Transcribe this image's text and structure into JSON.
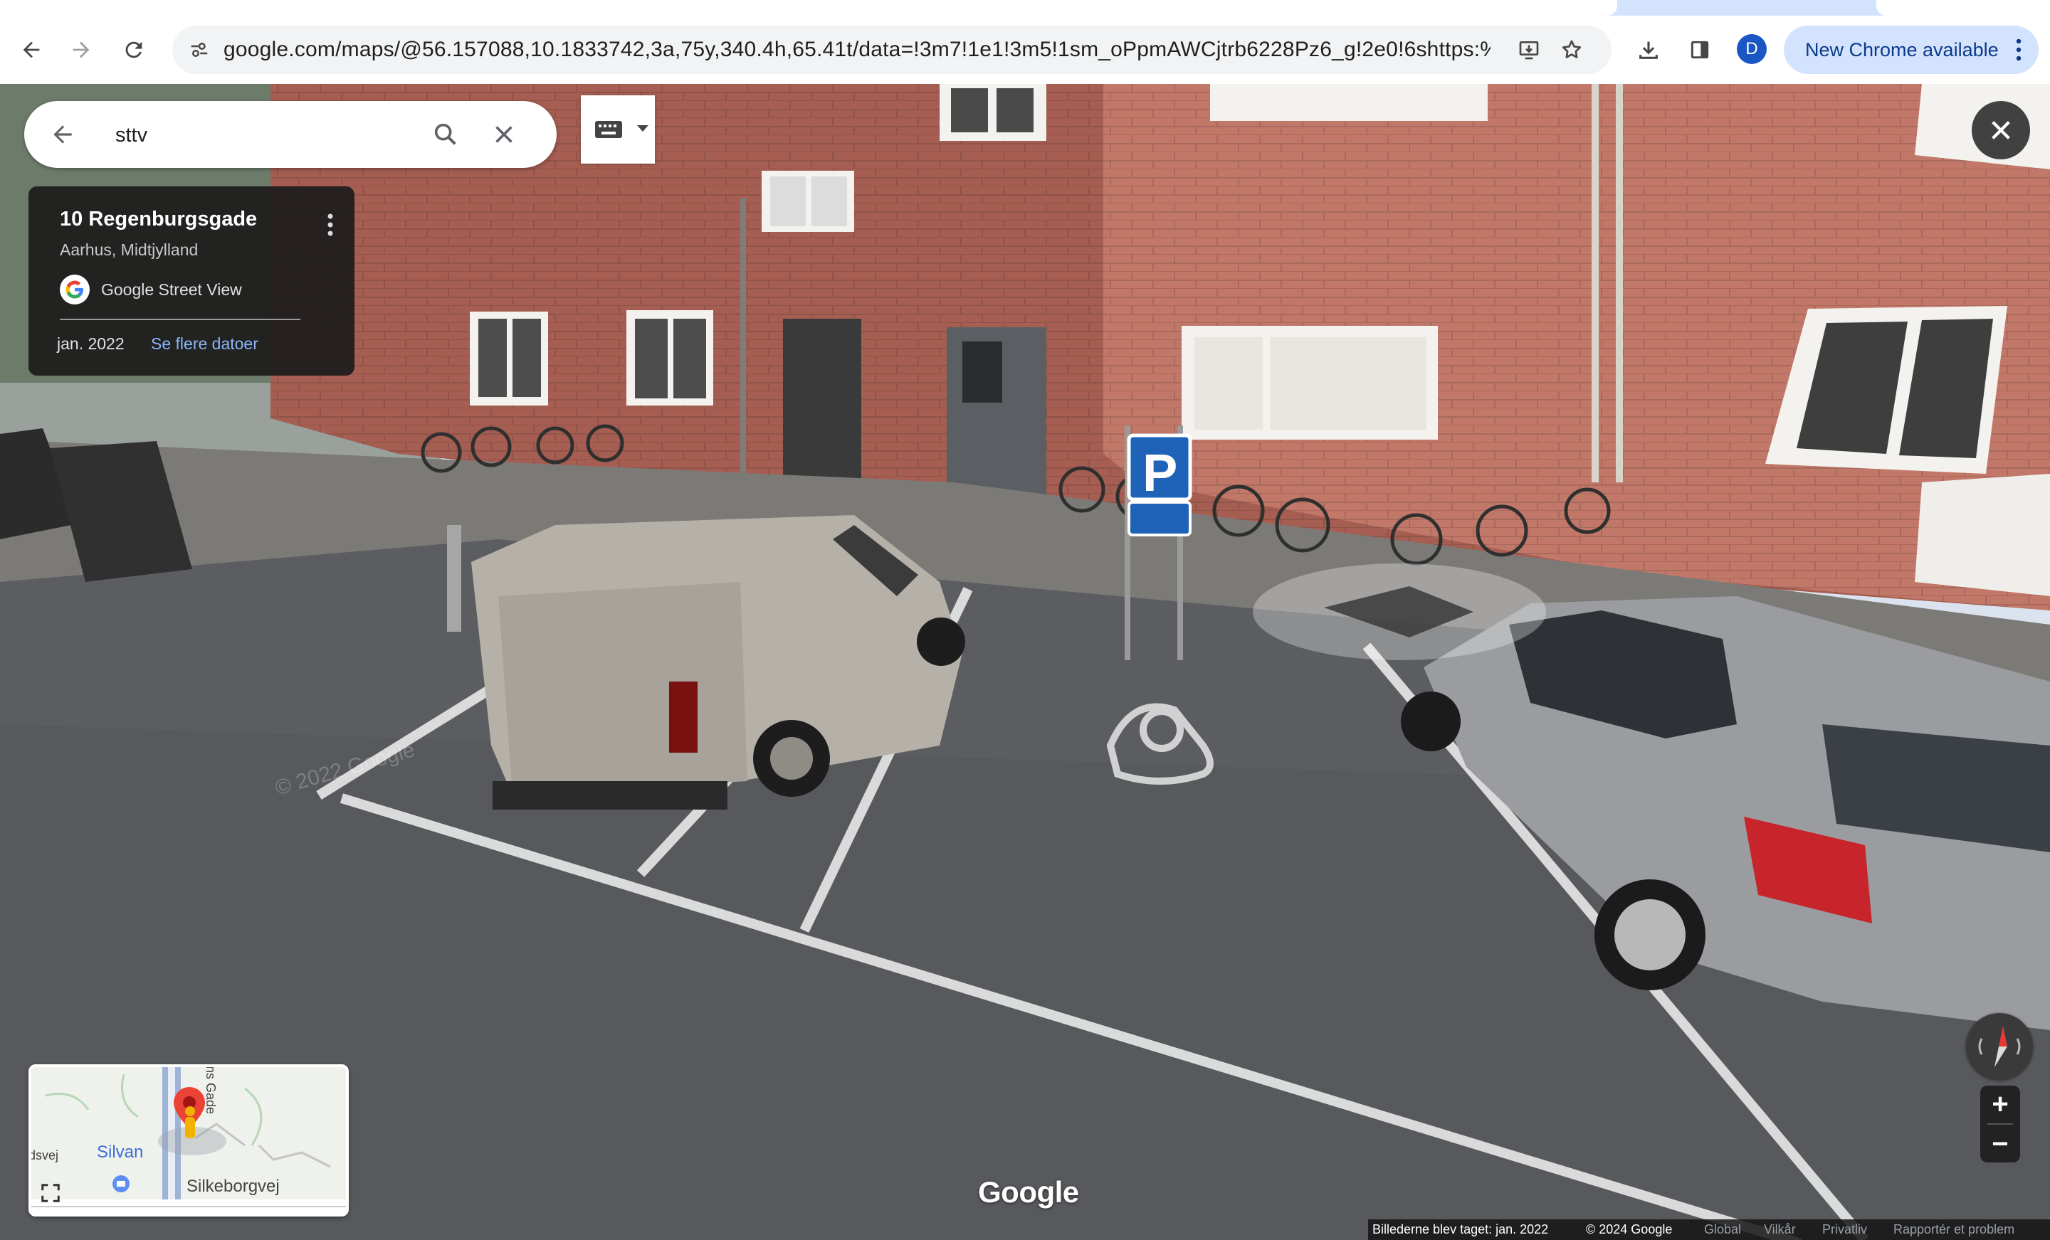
{
  "browser": {
    "url": "google.com/maps/@56.157088,10.1833742,3a,75y,340.4h,65.41t/data=!3m7!1e1!3m5!1sm_oPpmAWCjtrb6228Pz6_g!2e0!6shttps:%2...",
    "avatar_letter": "D",
    "update_label": "New Chrome available",
    "icons": [
      "back-arrow-icon",
      "forward-arrow-icon",
      "reload-icon",
      "site-info-icon",
      "install-app-icon",
      "bookmark-star-icon",
      "download-icon",
      "side-panel-icon",
      "more-vert-icon"
    ]
  },
  "search": {
    "value": "sttv",
    "icons": [
      "back-arrow-icon",
      "search-icon",
      "close-icon",
      "keyboard-icon",
      "dropdown-caret-icon"
    ]
  },
  "info_card": {
    "title": "10 Regenburgsgade",
    "subtitle": "Aarhus, Midtjylland",
    "source": "Google Street View",
    "date": "jan. 2022",
    "more_dates": "Se flere datoer"
  },
  "minimap": {
    "labels": [
      "Silvan",
      "Silkeborgvej",
      "dsvej",
      "ns Gade"
    ]
  },
  "controls": {
    "zoom_in": "+",
    "zoom_out": "−"
  },
  "footer": {
    "logo": "Google",
    "captured": "Billederne blev taget: jan. 2022",
    "copyright": "© 2024 Google",
    "global": "Global",
    "terms": "Vilkår",
    "privacy": "Privatliv",
    "report": "Rapportér et problem"
  },
  "colors": {
    "chrome_tab_accent": "#d3e3fd",
    "link_blue": "#8ab4f8",
    "pin_red": "#ea4335",
    "avatar_blue": "#1a56c4"
  }
}
